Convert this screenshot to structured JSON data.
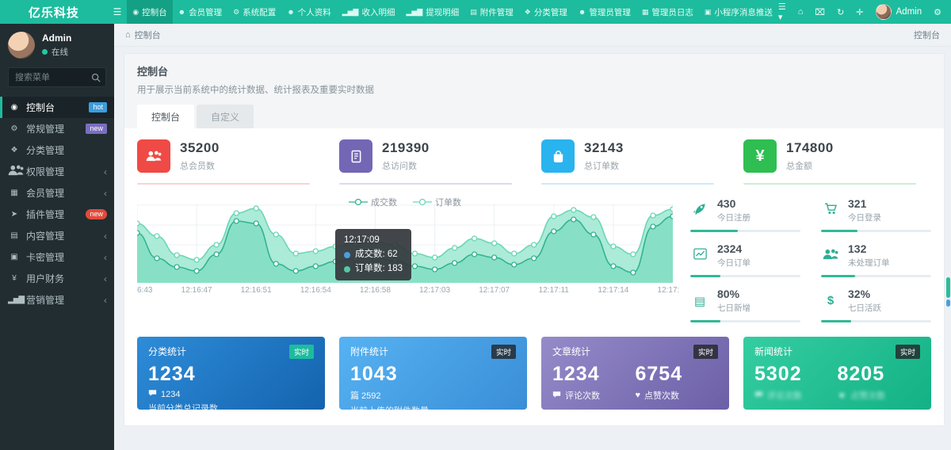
{
  "navbar": {
    "brand": "亿乐科技",
    "items": [
      {
        "icon": "dashboard-icon",
        "label": "控制台",
        "active": true
      },
      {
        "icon": "user-icon",
        "label": "会员管理"
      },
      {
        "icon": "gear-icon",
        "label": "系统配置"
      },
      {
        "icon": "user-icon",
        "label": "个人资料"
      },
      {
        "icon": "chart-bar-icon",
        "label": "收入明细"
      },
      {
        "icon": "chart-bar-icon",
        "label": "提现明细"
      },
      {
        "icon": "file-icon",
        "label": "附件管理"
      },
      {
        "icon": "tags-icon",
        "label": "分类管理"
      },
      {
        "icon": "admin-icon",
        "label": "管理员管理"
      },
      {
        "icon": "log-icon",
        "label": "管理员日志"
      },
      {
        "icon": "message-icon",
        "label": "小程序消息推送"
      }
    ],
    "right_icons": [
      "list-caret-icon",
      "home-icon",
      "trash-icon",
      "refresh-icon",
      "fullscreen-icon"
    ],
    "user_name": "Admin",
    "trailing_icon": "cogs-icon"
  },
  "sidebar": {
    "user_name": "Admin",
    "status": "在线",
    "search_placeholder": "搜索菜单",
    "items": [
      {
        "icon": "dashboard-icon",
        "label": "控制台",
        "badge": "hot",
        "badge_style": "blue",
        "active": true
      },
      {
        "icon": "cogs-icon",
        "label": "常规管理",
        "badge": "new",
        "badge_style": "purple"
      },
      {
        "icon": "tags-icon",
        "label": "分类管理"
      },
      {
        "icon": "users-icon",
        "label": "权限管理",
        "arrow": true
      },
      {
        "icon": "table-icon",
        "label": "会员管理",
        "arrow": true
      },
      {
        "icon": "plane-icon",
        "label": "插件管理",
        "badge": "new",
        "badge_style": "red"
      },
      {
        "icon": "file-icon",
        "label": "内容管理",
        "arrow": true
      },
      {
        "icon": "image-icon",
        "label": "卡密管理",
        "arrow": true
      },
      {
        "icon": "yen-icon",
        "label": "用户财务",
        "arrow": true
      },
      {
        "icon": "chart-bar-icon",
        "label": "营销管理",
        "arrow": true
      }
    ]
  },
  "breadcrumb": {
    "left": "控制台",
    "right": "控制台"
  },
  "panel": {
    "title": "控制台",
    "description": "用于展示当前系统中的统计数据、统计报表及重要实时数据",
    "tabs": [
      {
        "label": "控制台",
        "active": true
      },
      {
        "label": "自定义",
        "active": false
      }
    ]
  },
  "stats": [
    {
      "value": "35200",
      "label": "总会员数",
      "color": "#ef4a45",
      "icon": "users-icon"
    },
    {
      "value": "219390",
      "label": "总访问数",
      "color": "#7367b5",
      "icon": "book-icon"
    },
    {
      "value": "32143",
      "label": "总订单数",
      "color": "#29b3ef",
      "icon": "bag-icon"
    },
    {
      "value": "174800",
      "label": "总金额",
      "color": "#2fbe51",
      "icon": "yen-icon"
    }
  ],
  "chart_data": {
    "type": "area",
    "title": "",
    "legend": [
      "成交数",
      "订单数"
    ],
    "legend_position": "top-center",
    "grid": true,
    "ylim": [
      0,
      200
    ],
    "x_ticks": [
      "6:43",
      "12:16:47",
      "12:16:51",
      "12:16:54",
      "12:16:58",
      "12:17:03",
      "12:17:07",
      "12:17:11",
      "12:17:14",
      "12:17:"
    ],
    "series": [
      {
        "name": "订单数",
        "color": "#6cd6b6",
        "fill": "#a7ead5",
        "fill_opacity": 0.95,
        "values": [
          150,
          118,
          70,
          58,
          96,
          176,
          188,
          122,
          74,
          80,
          92,
          98,
          104,
          96,
          74,
          64,
          88,
          112,
          100,
          74,
          96,
          168,
          184,
          166,
          92,
          72,
          170,
          186
        ]
      },
      {
        "name": "成交数",
        "color": "#33b291",
        "fill": "#7eddc0",
        "fill_opacity": 0.8,
        "values": [
          126,
          62,
          40,
          30,
          72,
          156,
          150,
          48,
          30,
          42,
          54,
          60,
          62,
          56,
          42,
          34,
          50,
          72,
          64,
          46,
          62,
          130,
          160,
          122,
          42,
          26,
          142,
          168
        ]
      }
    ],
    "tooltip": {
      "title": "12:17:09",
      "rows": [
        {
          "label": "成交数",
          "value": "62",
          "color": "#4a9fe0"
        },
        {
          "label": "订单数",
          "value": "183",
          "color": "#57c7a3"
        }
      ]
    }
  },
  "mini_stats": [
    {
      "icon": "rocket-icon",
      "value": "430",
      "label": "今日注册",
      "progress": 43
    },
    {
      "icon": "cart-icon",
      "value": "321",
      "label": "今日登录",
      "progress": 33
    },
    {
      "icon": "chart-line-icon",
      "value": "2324",
      "label": "今日订单",
      "progress": 27
    },
    {
      "icon": "users-icon",
      "value": "132",
      "label": "未处理订单",
      "progress": 31
    },
    {
      "icon": "list-icon",
      "value": "80%",
      "label": "七日新增",
      "progress": 27
    },
    {
      "icon": "dollar-icon",
      "value": "32%",
      "label": "七日活跃",
      "progress": 27
    }
  ],
  "bottom_cards": [
    {
      "title": "分类统计",
      "badge": "实时",
      "badge_style": "green",
      "theme": [
        "#2e8cd8",
        "#1463ae"
      ],
      "metrics": [
        {
          "value": "1234"
        }
      ],
      "sub_icon": "comment-icon",
      "sub_text": "1234",
      "label": "当前分类总记录数"
    },
    {
      "title": "附件统计",
      "badge": "实时",
      "badge_style": "dark",
      "theme": [
        "#56b2f2",
        "#3a8ed6"
      ],
      "metrics": [
        {
          "value": "1043"
        }
      ],
      "sub_text": "篇 2592",
      "label": "当前上传的附件数量"
    },
    {
      "title": "文章统计",
      "badge": "实时",
      "badge_style": "dark",
      "theme": [
        "#958bc9",
        "#6c5fa7"
      ],
      "metrics": [
        {
          "value": "1234",
          "icon": "comment-icon",
          "label": "评论次数"
        },
        {
          "value": "6754",
          "icon": "heart-icon",
          "label": "点赞次数"
        }
      ]
    },
    {
      "title": "新闻统计",
      "badge": "实时",
      "badge_style": "dark",
      "theme": [
        "#35cda2",
        "#13b185"
      ],
      "blurred": true,
      "metrics": [
        {
          "value": "5302",
          "icon": "comment-icon",
          "label": "评论次数"
        },
        {
          "value": "8205",
          "icon": "user-icon",
          "label": "点赞次数"
        }
      ]
    }
  ]
}
